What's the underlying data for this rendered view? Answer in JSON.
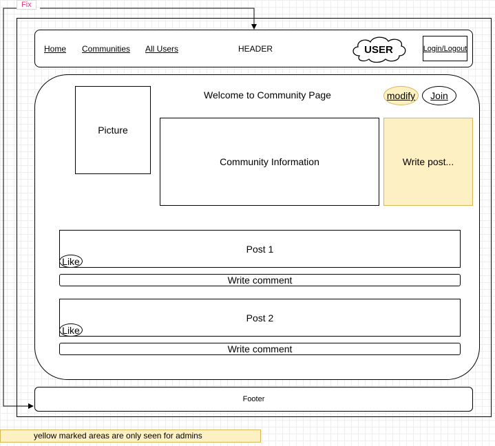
{
  "fix_label": "Fix",
  "header": {
    "nav": [
      "Home",
      "Communities",
      "All Users"
    ],
    "title": "HEADER",
    "user": "USER",
    "login": "Login/Logout"
  },
  "main": {
    "welcome": "Welcome to Community Page",
    "modify": "modify",
    "join": "Join",
    "picture": "Picture",
    "community_info": "Community Information",
    "write_post": "Write post...",
    "posts": [
      {
        "title": "Post 1",
        "like": "Like",
        "comment": "Write comment"
      },
      {
        "title": "Post 2",
        "like": "Like",
        "comment": "Write comment"
      }
    ]
  },
  "footer": "Footer",
  "note": "yellow marked areas are only seen for admins",
  "colors": {
    "admin_fill": "#fdf0c2",
    "admin_stroke": "#d6b656",
    "fix_text": "#e0347a"
  }
}
